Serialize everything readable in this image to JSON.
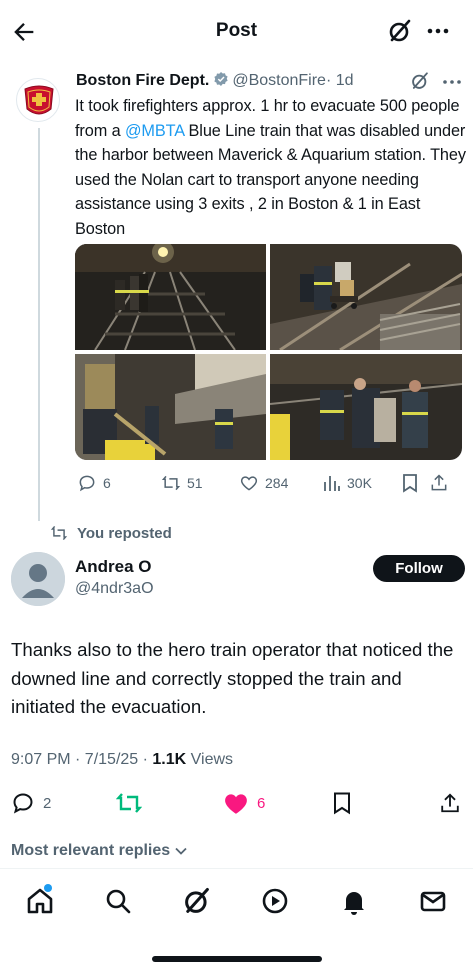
{
  "header": {
    "title": "Post",
    "back_icon": "arrow-left-icon",
    "grok_icon": "grok-icon",
    "more_icon": "more-horizontal-icon"
  },
  "quoted_post": {
    "author_name": "Boston Fire Dept.",
    "author_handle": "@BostonFire",
    "time": "· 1d",
    "avatar_badge_text": "BOSTON FIRE",
    "verified_icon": "verified-badge-icon",
    "text_before_mention": "It took firefighters approx. 1 hr to evacuate 500 people from a ",
    "mention": "@MBTA",
    "text_after_mention": " Blue Line train that was disabled under the harbor between Maverick & Aquarium station. They  used the Nolan cart to transport anyone needing assistance using 3 exits , 2 in Boston & 1 in East Boston",
    "media": [
      {
        "alt": "Firefighters walking along dark subway tunnel tracks"
      },
      {
        "alt": "Firefighters pushing Nolan cart on tracks"
      },
      {
        "alt": "Firefighters and passengers on platform stairs"
      },
      {
        "alt": "Firefighters assisting passenger on tracks"
      }
    ],
    "actions": {
      "replies": "6",
      "reposts": "51",
      "likes": "284",
      "views": "30K"
    }
  },
  "repost_label": "You reposted",
  "post": {
    "author_name": "Andrea O",
    "author_handle": "@4ndr3aO",
    "follow_label": "Follow",
    "text": "Thanks also to the hero train operator that noticed the downed line and correctly stopped the train and initiated the evacuation.",
    "time": "9:07 PM · 7/15/25 · ",
    "views_count": "1.1K",
    "views_label": " Views",
    "actions": {
      "replies": "2",
      "reposts": "",
      "likes": "6"
    }
  },
  "replies_sort": "Most relevant replies",
  "bottom_nav": [
    "home-icon",
    "search-icon",
    "grok-icon",
    "video-icon",
    "notifications-icon",
    "messages-icon"
  ],
  "colors": {
    "accent": "#1d9bf0",
    "repost_green": "#00ba7c",
    "like_pink": "#f91880",
    "text": "#0f1419",
    "muted": "#536471"
  }
}
